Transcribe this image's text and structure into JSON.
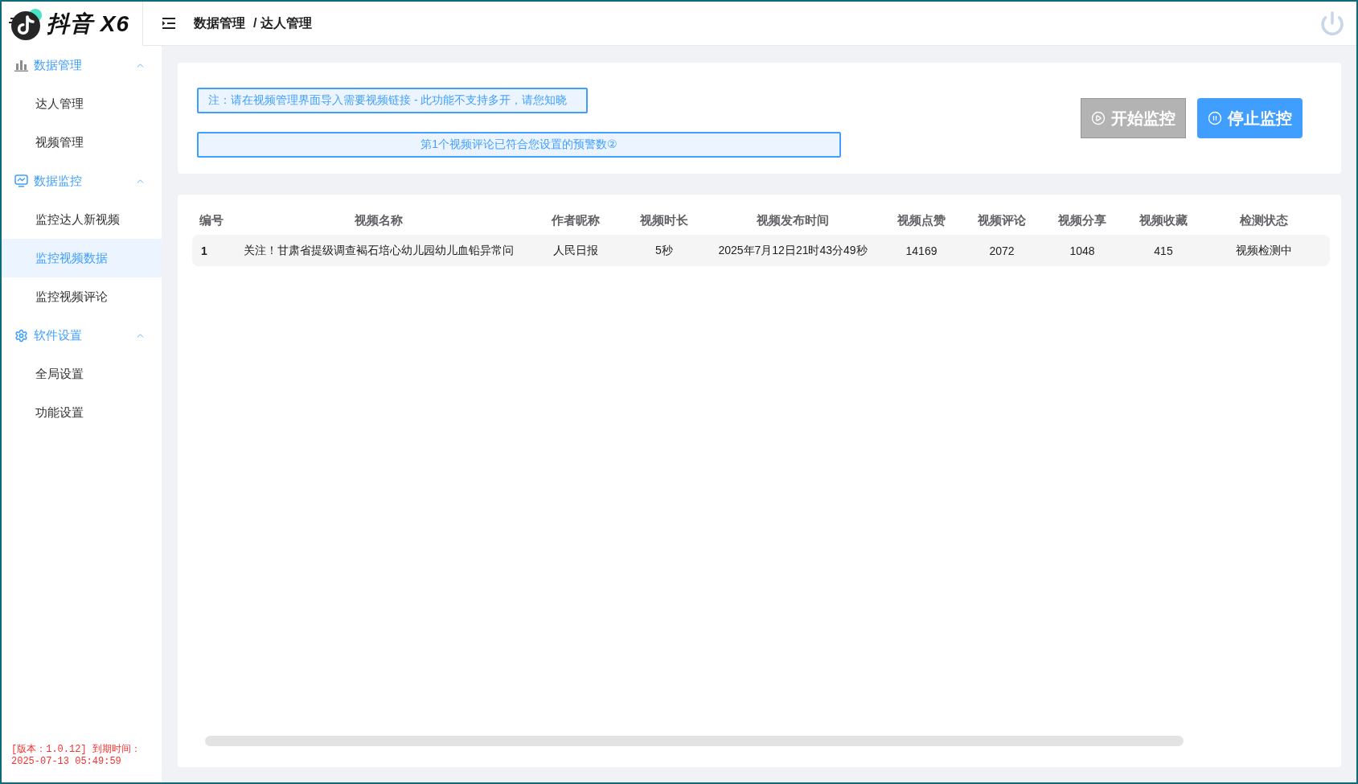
{
  "logo": {
    "text": "抖音 X6"
  },
  "header": {
    "breadcrumb": [
      "数据管理",
      "达人管理"
    ],
    "separator": "/"
  },
  "sidebar": {
    "groups": [
      {
        "label": "数据管理",
        "kind": "chart",
        "expanded": true,
        "items": [
          {
            "label": "达人管理",
            "selected": false
          },
          {
            "label": "视频管理",
            "selected": false
          }
        ]
      },
      {
        "label": "数据监控",
        "kind": "monitor",
        "expanded": true,
        "items": [
          {
            "label": "监控达人新视频",
            "selected": false
          },
          {
            "label": "监控视频数据",
            "selected": true
          },
          {
            "label": "监控视频评论",
            "selected": false
          }
        ]
      },
      {
        "label": "软件设置",
        "kind": "settings",
        "expanded": true,
        "items": [
          {
            "label": "全局设置",
            "selected": false
          },
          {
            "label": "功能设置",
            "selected": false
          }
        ]
      }
    ],
    "footer": {
      "lines": [
        "[版本：1.0.12] 到期时间：",
        "2025-07-13 05:49:59"
      ]
    }
  },
  "notices": [
    {
      "kind": "note",
      "text": "注：请在视频管理界面导入需要视频链接 - 此功能不支持多开，请您知晓"
    },
    {
      "kind": "alert",
      "text": "第1个视频评论已符合您设置的预警数②"
    }
  ],
  "buttons": [
    {
      "label": "开始监控",
      "kind": "start",
      "disabled": true
    },
    {
      "label": "停止监控",
      "kind": "stop",
      "disabled": false
    }
  ],
  "table": {
    "columns": [
      "编号",
      "视频名称",
      "作者昵称",
      "视频时长",
      "视频发布时间",
      "视频点赞",
      "视频评论",
      "视频分享",
      "视频收藏",
      "检测状态"
    ],
    "rows": [
      {
        "cells": [
          "1",
          "关注！甘肃省提级调查褐石培心幼儿园幼儿血铅异常问",
          "人民日报",
          "5秒",
          "2025年7月12日21时43分49秒",
          "14169",
          "2072",
          "1048",
          "415",
          "视频检测中"
        ]
      }
    ]
  }
}
